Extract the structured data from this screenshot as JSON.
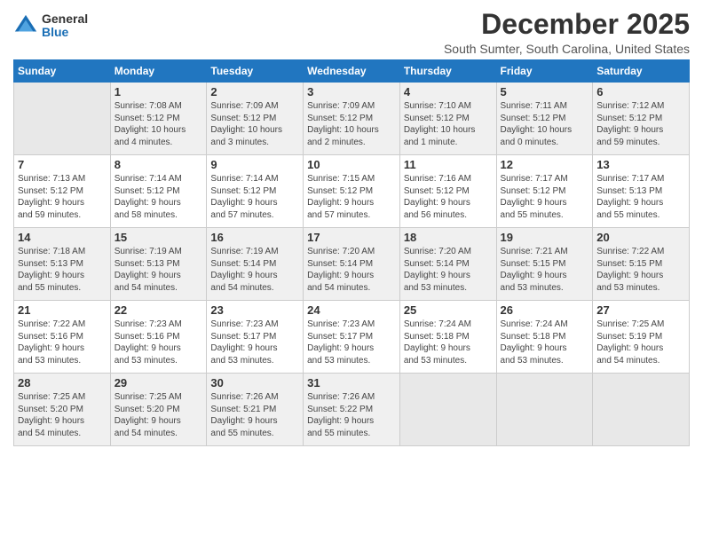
{
  "logo": {
    "general": "General",
    "blue": "Blue"
  },
  "title": "December 2025",
  "location": "South Sumter, South Carolina, United States",
  "days_of_week": [
    "Sunday",
    "Monday",
    "Tuesday",
    "Wednesday",
    "Thursday",
    "Friday",
    "Saturday"
  ],
  "weeks": [
    [
      {
        "day": "",
        "info": ""
      },
      {
        "day": "1",
        "info": "Sunrise: 7:08 AM\nSunset: 5:12 PM\nDaylight: 10 hours\nand 4 minutes."
      },
      {
        "day": "2",
        "info": "Sunrise: 7:09 AM\nSunset: 5:12 PM\nDaylight: 10 hours\nand 3 minutes."
      },
      {
        "day": "3",
        "info": "Sunrise: 7:09 AM\nSunset: 5:12 PM\nDaylight: 10 hours\nand 2 minutes."
      },
      {
        "day": "4",
        "info": "Sunrise: 7:10 AM\nSunset: 5:12 PM\nDaylight: 10 hours\nand 1 minute."
      },
      {
        "day": "5",
        "info": "Sunrise: 7:11 AM\nSunset: 5:12 PM\nDaylight: 10 hours\nand 0 minutes."
      },
      {
        "day": "6",
        "info": "Sunrise: 7:12 AM\nSunset: 5:12 PM\nDaylight: 9 hours\nand 59 minutes."
      }
    ],
    [
      {
        "day": "7",
        "info": "Sunrise: 7:13 AM\nSunset: 5:12 PM\nDaylight: 9 hours\nand 59 minutes."
      },
      {
        "day": "8",
        "info": "Sunrise: 7:14 AM\nSunset: 5:12 PM\nDaylight: 9 hours\nand 58 minutes."
      },
      {
        "day": "9",
        "info": "Sunrise: 7:14 AM\nSunset: 5:12 PM\nDaylight: 9 hours\nand 57 minutes."
      },
      {
        "day": "10",
        "info": "Sunrise: 7:15 AM\nSunset: 5:12 PM\nDaylight: 9 hours\nand 57 minutes."
      },
      {
        "day": "11",
        "info": "Sunrise: 7:16 AM\nSunset: 5:12 PM\nDaylight: 9 hours\nand 56 minutes."
      },
      {
        "day": "12",
        "info": "Sunrise: 7:17 AM\nSunset: 5:12 PM\nDaylight: 9 hours\nand 55 minutes."
      },
      {
        "day": "13",
        "info": "Sunrise: 7:17 AM\nSunset: 5:13 PM\nDaylight: 9 hours\nand 55 minutes."
      }
    ],
    [
      {
        "day": "14",
        "info": "Sunrise: 7:18 AM\nSunset: 5:13 PM\nDaylight: 9 hours\nand 55 minutes."
      },
      {
        "day": "15",
        "info": "Sunrise: 7:19 AM\nSunset: 5:13 PM\nDaylight: 9 hours\nand 54 minutes."
      },
      {
        "day": "16",
        "info": "Sunrise: 7:19 AM\nSunset: 5:14 PM\nDaylight: 9 hours\nand 54 minutes."
      },
      {
        "day": "17",
        "info": "Sunrise: 7:20 AM\nSunset: 5:14 PM\nDaylight: 9 hours\nand 54 minutes."
      },
      {
        "day": "18",
        "info": "Sunrise: 7:20 AM\nSunset: 5:14 PM\nDaylight: 9 hours\nand 53 minutes."
      },
      {
        "day": "19",
        "info": "Sunrise: 7:21 AM\nSunset: 5:15 PM\nDaylight: 9 hours\nand 53 minutes."
      },
      {
        "day": "20",
        "info": "Sunrise: 7:22 AM\nSunset: 5:15 PM\nDaylight: 9 hours\nand 53 minutes."
      }
    ],
    [
      {
        "day": "21",
        "info": "Sunrise: 7:22 AM\nSunset: 5:16 PM\nDaylight: 9 hours\nand 53 minutes."
      },
      {
        "day": "22",
        "info": "Sunrise: 7:23 AM\nSunset: 5:16 PM\nDaylight: 9 hours\nand 53 minutes."
      },
      {
        "day": "23",
        "info": "Sunrise: 7:23 AM\nSunset: 5:17 PM\nDaylight: 9 hours\nand 53 minutes."
      },
      {
        "day": "24",
        "info": "Sunrise: 7:23 AM\nSunset: 5:17 PM\nDaylight: 9 hours\nand 53 minutes."
      },
      {
        "day": "25",
        "info": "Sunrise: 7:24 AM\nSunset: 5:18 PM\nDaylight: 9 hours\nand 53 minutes."
      },
      {
        "day": "26",
        "info": "Sunrise: 7:24 AM\nSunset: 5:18 PM\nDaylight: 9 hours\nand 53 minutes."
      },
      {
        "day": "27",
        "info": "Sunrise: 7:25 AM\nSunset: 5:19 PM\nDaylight: 9 hours\nand 54 minutes."
      }
    ],
    [
      {
        "day": "28",
        "info": "Sunrise: 7:25 AM\nSunset: 5:20 PM\nDaylight: 9 hours\nand 54 minutes."
      },
      {
        "day": "29",
        "info": "Sunrise: 7:25 AM\nSunset: 5:20 PM\nDaylight: 9 hours\nand 54 minutes."
      },
      {
        "day": "30",
        "info": "Sunrise: 7:26 AM\nSunset: 5:21 PM\nDaylight: 9 hours\nand 55 minutes."
      },
      {
        "day": "31",
        "info": "Sunrise: 7:26 AM\nSunset: 5:22 PM\nDaylight: 9 hours\nand 55 minutes."
      },
      {
        "day": "",
        "info": ""
      },
      {
        "day": "",
        "info": ""
      },
      {
        "day": "",
        "info": ""
      }
    ]
  ]
}
